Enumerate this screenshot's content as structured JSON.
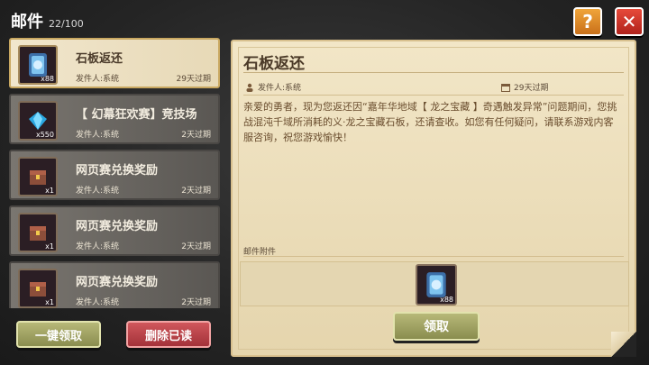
{
  "header": {
    "title": "邮件",
    "count": "22/100"
  },
  "top_buttons": {
    "help": "?",
    "close": "✕"
  },
  "mail_list": [
    {
      "title": "石板返还",
      "sender": "发件人:系统",
      "expire": "29天过期",
      "qty": "x88",
      "icon": "stone-tablet-icon",
      "selected": true
    },
    {
      "title": "【 幻幕狂欢赛】竞技场",
      "sender": "发件人:系统",
      "expire": "2天过期",
      "qty": "x550",
      "icon": "blue-gem-icon",
      "selected": false
    },
    {
      "title": "网页赛兑换奖励",
      "sender": "发件人:系统",
      "expire": "2天过期",
      "qty": "x1",
      "icon": "reward-chest-icon",
      "selected": false
    },
    {
      "title": "网页赛兑换奖励",
      "sender": "发件人:系统",
      "expire": "2天过期",
      "qty": "x1",
      "icon": "reward-chest-icon",
      "selected": false
    },
    {
      "title": "网页赛兑换奖励",
      "sender": "发件人:系统",
      "expire": "2天过期",
      "qty": "x1",
      "icon": "reward-chest-icon",
      "selected": false
    }
  ],
  "actions": {
    "collect_all": "一键领取",
    "delete_read": "删除已读"
  },
  "detail": {
    "title": "石板返还",
    "sender": "发件人:系统",
    "expire": "29天过期",
    "body": "亲爱的勇者，现为您返还因“嘉年华地域【 龙之宝藏 】奇遇触发异常”问题期间，您挑战混沌千域所消耗的义·龙之宝藏石板，还请查收。如您有任何疑问，请联系游戏内客服咨询，祝您游戏愉快！",
    "attachment_label": "邮件附件",
    "attachment_qty": "x88",
    "claim": "领取"
  },
  "colors": {
    "accent_green": "#8a8d4f",
    "accent_red": "#a33239",
    "paper": "#f2e6c7"
  }
}
